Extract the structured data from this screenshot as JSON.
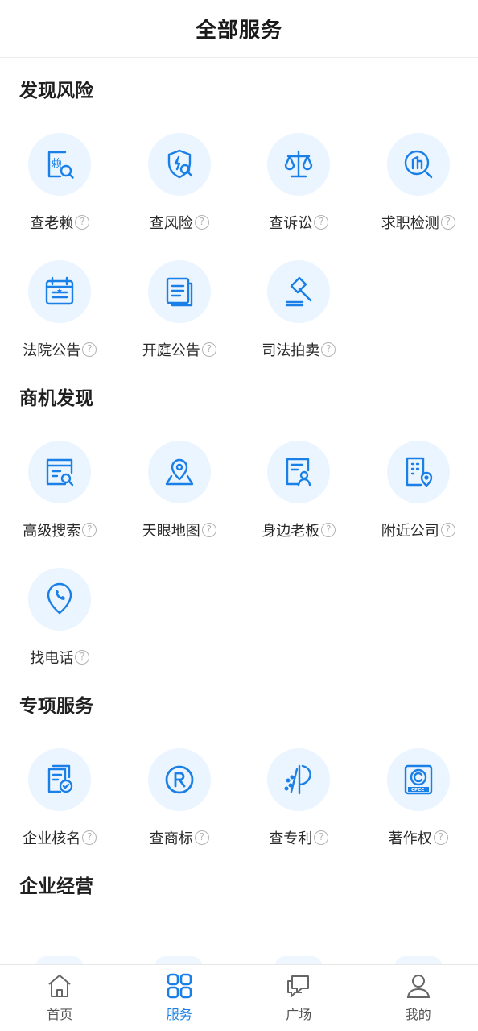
{
  "header": {
    "title": "全部服务"
  },
  "sections": [
    {
      "title": "发现风险",
      "items": [
        {
          "label": "查老赖",
          "icon": "defaulter-search-icon"
        },
        {
          "label": "查风险",
          "icon": "risk-shield-search-icon"
        },
        {
          "label": "查诉讼",
          "icon": "scales-icon"
        },
        {
          "label": "求职检测",
          "icon": "building-search-icon"
        },
        {
          "label": "法院公告",
          "icon": "calendar-announcement-icon"
        },
        {
          "label": "开庭公告",
          "icon": "document-stack-icon"
        },
        {
          "label": "司法拍卖",
          "icon": "gavel-icon"
        }
      ]
    },
    {
      "title": "商机发现",
      "items": [
        {
          "label": "高级搜索",
          "icon": "advanced-search-icon"
        },
        {
          "label": "天眼地图",
          "icon": "map-pin-icon"
        },
        {
          "label": "身边老板",
          "icon": "boss-profile-icon"
        },
        {
          "label": "附近公司",
          "icon": "nearby-building-icon"
        },
        {
          "label": "找电话",
          "icon": "phone-pin-icon"
        }
      ]
    },
    {
      "title": "专项服务",
      "items": [
        {
          "label": "企业核名",
          "icon": "name-check-icon"
        },
        {
          "label": "查商标",
          "icon": "registered-trademark-icon"
        },
        {
          "label": "查专利",
          "icon": "patent-icon"
        },
        {
          "label": "著作权",
          "icon": "copyright-cpcc-icon"
        }
      ]
    },
    {
      "title": "企业经营",
      "items": []
    }
  ],
  "tabbar": {
    "items": [
      {
        "label": "首页",
        "icon": "home-icon",
        "active": false
      },
      {
        "label": "服务",
        "icon": "grid-services-icon",
        "active": true
      },
      {
        "label": "广场",
        "icon": "chat-bubbles-icon",
        "active": false
      },
      {
        "label": "我的",
        "icon": "user-icon",
        "active": false
      }
    ]
  },
  "colors": {
    "accent": "#1a7fe6",
    "icon_bg": "#eaf5ff",
    "inactive": "#555555"
  }
}
